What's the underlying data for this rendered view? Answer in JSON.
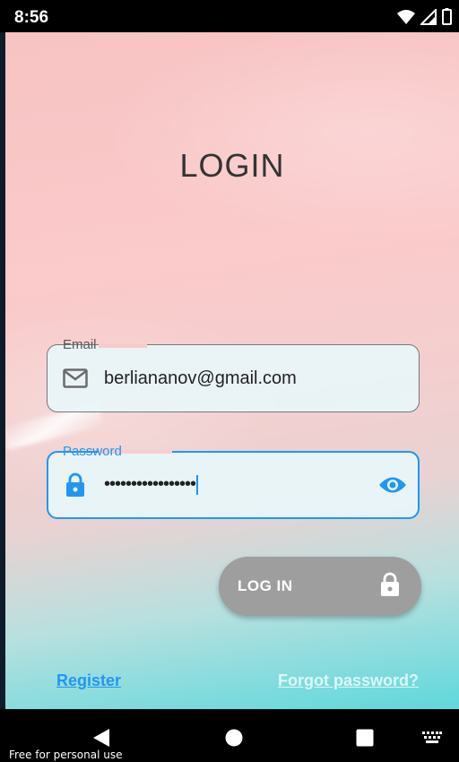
{
  "status_bar": {
    "time": "8:56",
    "icons": [
      "wifi-icon",
      "signal-icon",
      "battery-icon"
    ]
  },
  "screen": {
    "title": "LOGIN",
    "email_field": {
      "label": "Email",
      "value": "berliananov@gmail.com",
      "icon": "mail-icon"
    },
    "password_field": {
      "label": "Password",
      "value": "•••••••••••••••••",
      "icon": "lock-icon",
      "toggle_icon": "eye-icon",
      "focused": true
    },
    "login_button": {
      "label": "LOG IN",
      "icon": "lock-icon"
    },
    "register_link": "Register",
    "forgot_password_link": "Forgot password?"
  },
  "nav_bar": {
    "buttons": [
      "back-icon",
      "home-icon",
      "recents-icon",
      "keyboard-icon"
    ]
  },
  "watermark": "Free for personal use",
  "colors": {
    "accent": "#2196f3",
    "button_bg": "#9e9e9e",
    "title_text": "#333333"
  }
}
